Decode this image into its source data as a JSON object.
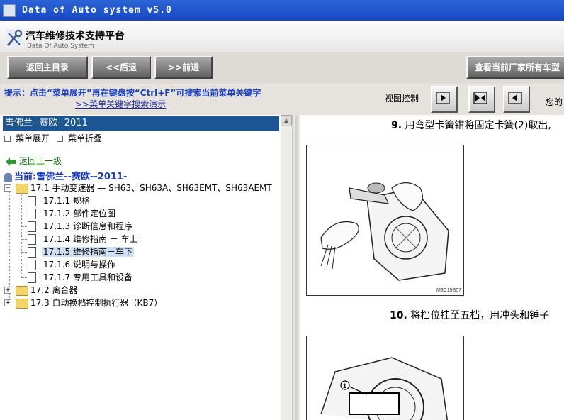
{
  "window": {
    "title": "Data of Auto system v5.0"
  },
  "header": {
    "title_cn": "汽车维修技术支持平台",
    "title_en": "Data Of Auto System"
  },
  "nav": {
    "home_label": "返回主目录",
    "back_label": "<<后退",
    "forward_label": ">>前进",
    "manufacturer_label": "查看当前厂家所有车型"
  },
  "info": {
    "hint": "提示：点击“菜单展开”再在键盘按“Ctrl+F”可搜索当前菜单关键字",
    "search_demo_link": ">>菜单关键字搜索演示",
    "view_control_label": "视图控制",
    "truncated_text": "您的"
  },
  "sidebar": {
    "car": "雪佛兰--赛欧--2011-",
    "expand_label": "菜单展开",
    "collapse_label": "菜单折叠",
    "back_up_label": "返回上一级",
    "current_label": "当前:雪佛兰--赛欧--2011-",
    "tree": {
      "root": "17.1 手动变速器 — SH63、SH63A、SH63EMT、SH63AEMT",
      "children": [
        "17.1.1 规格",
        "17.1.2 部件定位图",
        "17.1.3 诊断信息和程序",
        "17.1.4 维修指南 － 车上",
        "17.1.5 维修指南－车下",
        "17.1.6 说明与操作",
        "17.1.7 专用工具和设备"
      ],
      "siblings": [
        "17.2 离合器",
        "17.3 自动换档控制执行器（KB7）"
      ]
    }
  },
  "content": {
    "step9_num": "9.",
    "step9_text": "用弯型卡簧钳将固定卡簧(2)取出,",
    "figure1_code": "M3C15B07",
    "step10_num": "10.",
    "step10_text": "将档位挂至五档，用冲头和锤子",
    "figure2_callout": "1"
  }
}
